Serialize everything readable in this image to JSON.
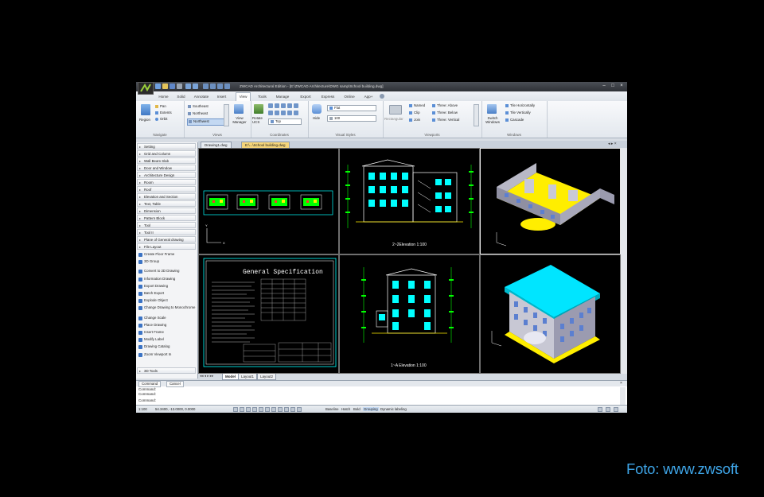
{
  "app": {
    "title": "ZWCAD Architectural Edition - [E:\\ZWCAD Architecture\\DWG samp\\School building.dwg]",
    "window_controls": [
      "–",
      "□",
      "×"
    ]
  },
  "ribbon": {
    "tabs": [
      "Home",
      "Solid",
      "Annotate",
      "Insert",
      "View",
      "Tools",
      "Manage",
      "Export",
      "Express",
      "Online",
      "App+"
    ],
    "active_tab": "View",
    "groups": {
      "navigate": {
        "label": "Navigate",
        "region_label": "Region",
        "items": [
          "Pan",
          "Extents",
          "Orbit"
        ]
      },
      "views": {
        "label": "Views",
        "items": [
          "Southeast",
          "Northeast",
          "Northwest"
        ],
        "selected": "Northwest",
        "view_manager": "View Manager"
      },
      "coordinates": {
        "label": "Coordinates",
        "rotate_ucs": "Rotate UCS",
        "ucs_view": "Top"
      },
      "visual_styles": {
        "label": "Visual Styles",
        "hide_label": "Hide",
        "style": "Flat",
        "value": "100"
      },
      "viewports": {
        "label": "Viewports",
        "rectangular": "Rectangular",
        "named": "Named",
        "clip": "Clip",
        "join": "Join",
        "layouts": [
          "Three: Above",
          "Three: Below",
          "Three: Vertical"
        ]
      },
      "windows": {
        "label": "Windows",
        "switch_windows": "Switch Windows",
        "items": [
          "Tile Horizontally",
          "Tile Vertically",
          "Cascade"
        ]
      }
    }
  },
  "palette": {
    "categories_top": [
      "Setting",
      "Grid and Column",
      "Wall Beam Slab",
      "Door and Window",
      "Architecture Design",
      "Room",
      "Roof",
      "Elevation and Section",
      "Text, Table",
      "Dimension",
      "Pattern Block",
      "Tool",
      "Tool II",
      "Plane of General drawing",
      "File Layout"
    ],
    "commands": [
      "Create Floor Frame",
      "3D Group",
      "Convert to 2D Drawing",
      "Information Drawing",
      "Export Drawing",
      "Batch Export",
      "Explode Object",
      "Change Drawing to Monochrome",
      "Change Scale",
      "Place Drawing",
      "Insert Frame",
      "Modify Label",
      "Drawing Catalog",
      "Zoom Viewport In"
    ],
    "categories_bottom": [
      "3D Tools"
    ]
  },
  "documents": {
    "tabs": [
      "Drawing1.dwg",
      "E:\\...\\School building.dwg"
    ],
    "active": 1
  },
  "viewports": {
    "elevation_top_label": "2~2Elevation 1:100",
    "spec_title": "General Specification",
    "elevation_bottom_label": "1~A Elevation 1:100"
  },
  "layout_tabs": [
    "Model",
    "Layout1",
    "Layout2"
  ],
  "command": {
    "tabs": [
      "Command",
      "Cancel"
    ],
    "lines": [
      "Command:",
      "Command:",
      "Command:"
    ]
  },
  "status": {
    "scale": "1:100",
    "coords": "54.3400, -13.0000, 0.0000",
    "toggles": [
      "Baseline",
      "Hatch",
      "Bold",
      "Grouping",
      "Dynamic labeling"
    ]
  },
  "caption": "Foto: www.zwsoft",
  "colors": {
    "cad_background": "#000000",
    "accent_cyan": "#00ffff",
    "accent_yellow": "#ffee00",
    "accent_green": "#00ff00",
    "caption_blue": "#3ea4e6"
  }
}
